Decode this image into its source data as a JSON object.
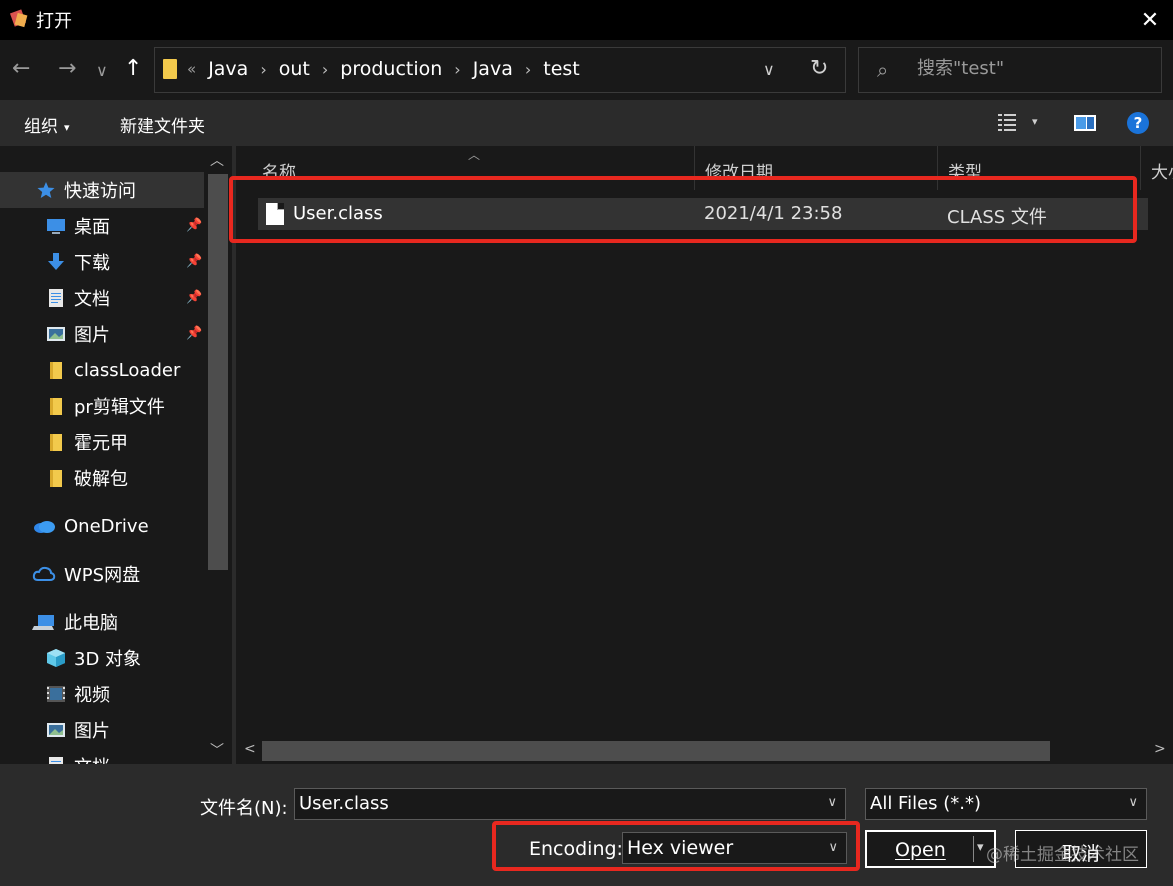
{
  "window": {
    "title": "打开",
    "close_glyph": "✕"
  },
  "nav": {
    "back_glyph": "←",
    "forward_glyph": "→",
    "recent_glyph": "∨",
    "up_glyph": "↑"
  },
  "address": {
    "lead": "«",
    "crumbs": [
      "Java",
      "out",
      "production",
      "Java",
      "test"
    ],
    "separator": "›",
    "dropdown_glyph": "∨",
    "refresh_glyph": "↻"
  },
  "search": {
    "placeholder": "搜索\"test\"",
    "icon_glyph": "⌕"
  },
  "toolbar": {
    "organize_label": "组织",
    "organize_caret": "▾",
    "new_folder_label": "新建文件夹",
    "view_caret": "▾",
    "help_label": "?"
  },
  "sidebar": {
    "scroll_up_glyph": "︿",
    "scroll_down_glyph": "﹀",
    "pin_glyph": "📌",
    "items": [
      {
        "label": "快速访问",
        "icon": "star-icon"
      },
      {
        "label": "桌面",
        "icon": "desktop-icon"
      },
      {
        "label": "下载",
        "icon": "download-icon"
      },
      {
        "label": "文档",
        "icon": "document-icon"
      },
      {
        "label": "图片",
        "icon": "picture-icon"
      },
      {
        "label": "classLoader",
        "icon": "folder-icon"
      },
      {
        "label": "pr剪辑文件",
        "icon": "folder-icon"
      },
      {
        "label": "霍元甲",
        "icon": "folder-icon"
      },
      {
        "label": "破解包",
        "icon": "folder-icon"
      },
      {
        "label": "OneDrive",
        "icon": "onedrive-icon"
      },
      {
        "label": "WPS网盘",
        "icon": "cloud-icon"
      },
      {
        "label": "此电脑",
        "icon": "computer-icon"
      },
      {
        "label": "3D 对象",
        "icon": "3d-objects-icon"
      },
      {
        "label": "视频",
        "icon": "video-icon"
      },
      {
        "label": "图片",
        "icon": "picture-icon"
      },
      {
        "label": "文档",
        "icon": "document-icon"
      }
    ]
  },
  "filelist": {
    "sort_glyph": "︿",
    "columns": [
      "名称",
      "修改日期",
      "类型",
      "大小"
    ],
    "rows": [
      {
        "name": "User.class",
        "modified": "2021/4/1 23:58",
        "type": "CLASS 文件"
      }
    ],
    "hscroll_left": "<",
    "hscroll_right": ">"
  },
  "bottom": {
    "filename_label": "文件名(N):",
    "filename_value": "User.class",
    "filter_value": "All Files (*.*)",
    "encoding_label": "Encoding:",
    "encoding_value": "Hex viewer",
    "open_label": "Open",
    "cancel_label": "取消",
    "dropdown_glyph": "∨",
    "open_caret": "▾",
    "watermark": "@稀土掘金技术社区"
  },
  "colors": {
    "highlight": "#e8281f",
    "background": "#191919",
    "toolbar": "#2b2b2b",
    "selection": "#333333",
    "help_blue": "#1a73d9",
    "folder_yellow": "#f2c94c"
  }
}
